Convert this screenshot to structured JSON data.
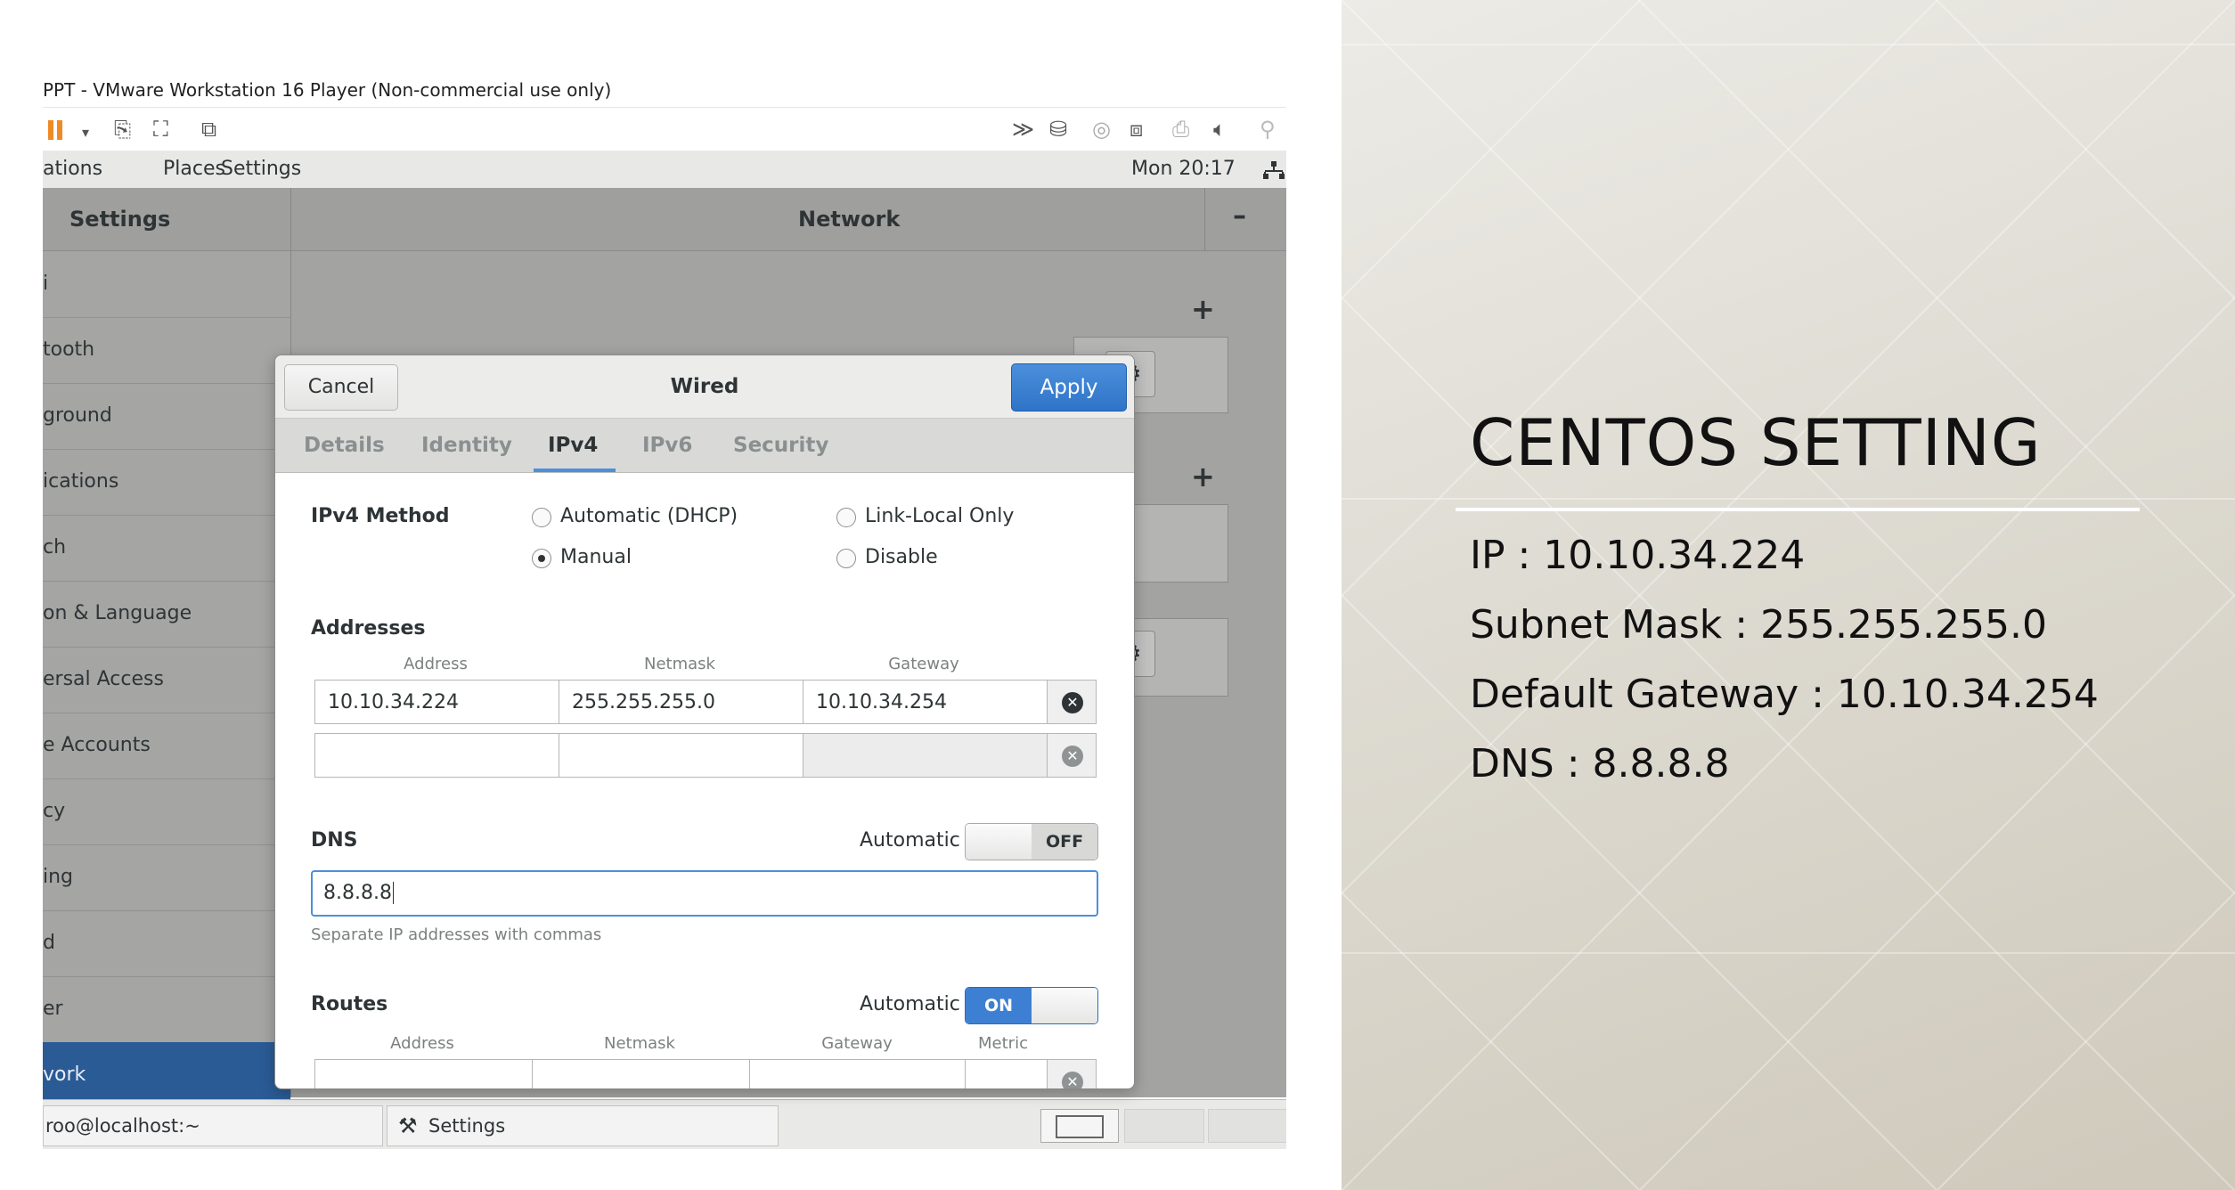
{
  "vm": {
    "window_title": "PPT - VMware Workstation 16 Player (Non-commercial use only)",
    "toolbar_icons": [
      "pause-icon",
      "dropdown-arrow-icon",
      "send-ctrl-alt-del-icon",
      "fullscreen-icon",
      "unity-icon",
      "forward-icon",
      "removable-device-icon",
      "cd-icon",
      "network-adapter-icon",
      "printer-icon",
      "sound-icon",
      "usb-icon"
    ]
  },
  "gnome": {
    "menu_applications": "ations",
    "menu_places": "Places",
    "menu_settings": "Settings",
    "clock": "Mon 20:17",
    "network_icon": "network-icon"
  },
  "settings": {
    "title": "Settings",
    "panel_title": "Network",
    "minimize": "–",
    "sidebar": [
      {
        "label": "i"
      },
      {
        "label": "tooth"
      },
      {
        "label": "ground"
      },
      {
        "label": "ications"
      },
      {
        "label": "ch"
      },
      {
        "label": "on & Language"
      },
      {
        "label": "ersal Access"
      },
      {
        "label": "e Accounts"
      },
      {
        "label": "cy"
      },
      {
        "label": "ing"
      },
      {
        "label": "d"
      },
      {
        "label": "er"
      },
      {
        "label": "vork"
      }
    ]
  },
  "taskbar": {
    "terminal": "roo@localhost:~",
    "settings": "Settings"
  },
  "dialog": {
    "cancel": "Cancel",
    "title": "Wired",
    "apply": "Apply",
    "tabs": [
      "Details",
      "Identity",
      "IPv4",
      "IPv6",
      "Security"
    ],
    "active_tab": "IPv4",
    "ipv4_method_label": "IPv4 Method",
    "methods": {
      "automatic": "Automatic (DHCP)",
      "link_local": "Link-Local Only",
      "manual": "Manual",
      "disable": "Disable",
      "selected": "Manual"
    },
    "addresses_label": "Addresses",
    "addr_headers": [
      "Address",
      "Netmask",
      "Gateway"
    ],
    "addresses": [
      {
        "address": "10.10.34.224",
        "netmask": "255.255.255.0",
        "gateway": "10.10.34.254"
      },
      {
        "address": "",
        "netmask": "",
        "gateway": ""
      }
    ],
    "dns_label": "DNS",
    "dns_automatic_label": "Automatic",
    "dns_switch": "OFF",
    "dns_value": "8.8.8.8",
    "dns_hint": "Separate IP addresses with commas",
    "routes_label": "Routes",
    "routes_automatic_label": "Automatic",
    "routes_switch": "ON",
    "route_headers": [
      "Address",
      "Netmask",
      "Gateway",
      "Metric"
    ]
  },
  "slide": {
    "title": "CENTOS SETTING",
    "lines": [
      "IP : 10.10.34.224",
      "Subnet Mask : 255.255.255.0",
      "Default Gateway : 10.10.34.254",
      "DNS : 8.8.8.8"
    ]
  },
  "colors": {
    "accent": "#4a90d9",
    "apply_button": "#2f74c8",
    "selected_sidebar": "#2a5b95",
    "pause_icon": "#f08a24"
  }
}
